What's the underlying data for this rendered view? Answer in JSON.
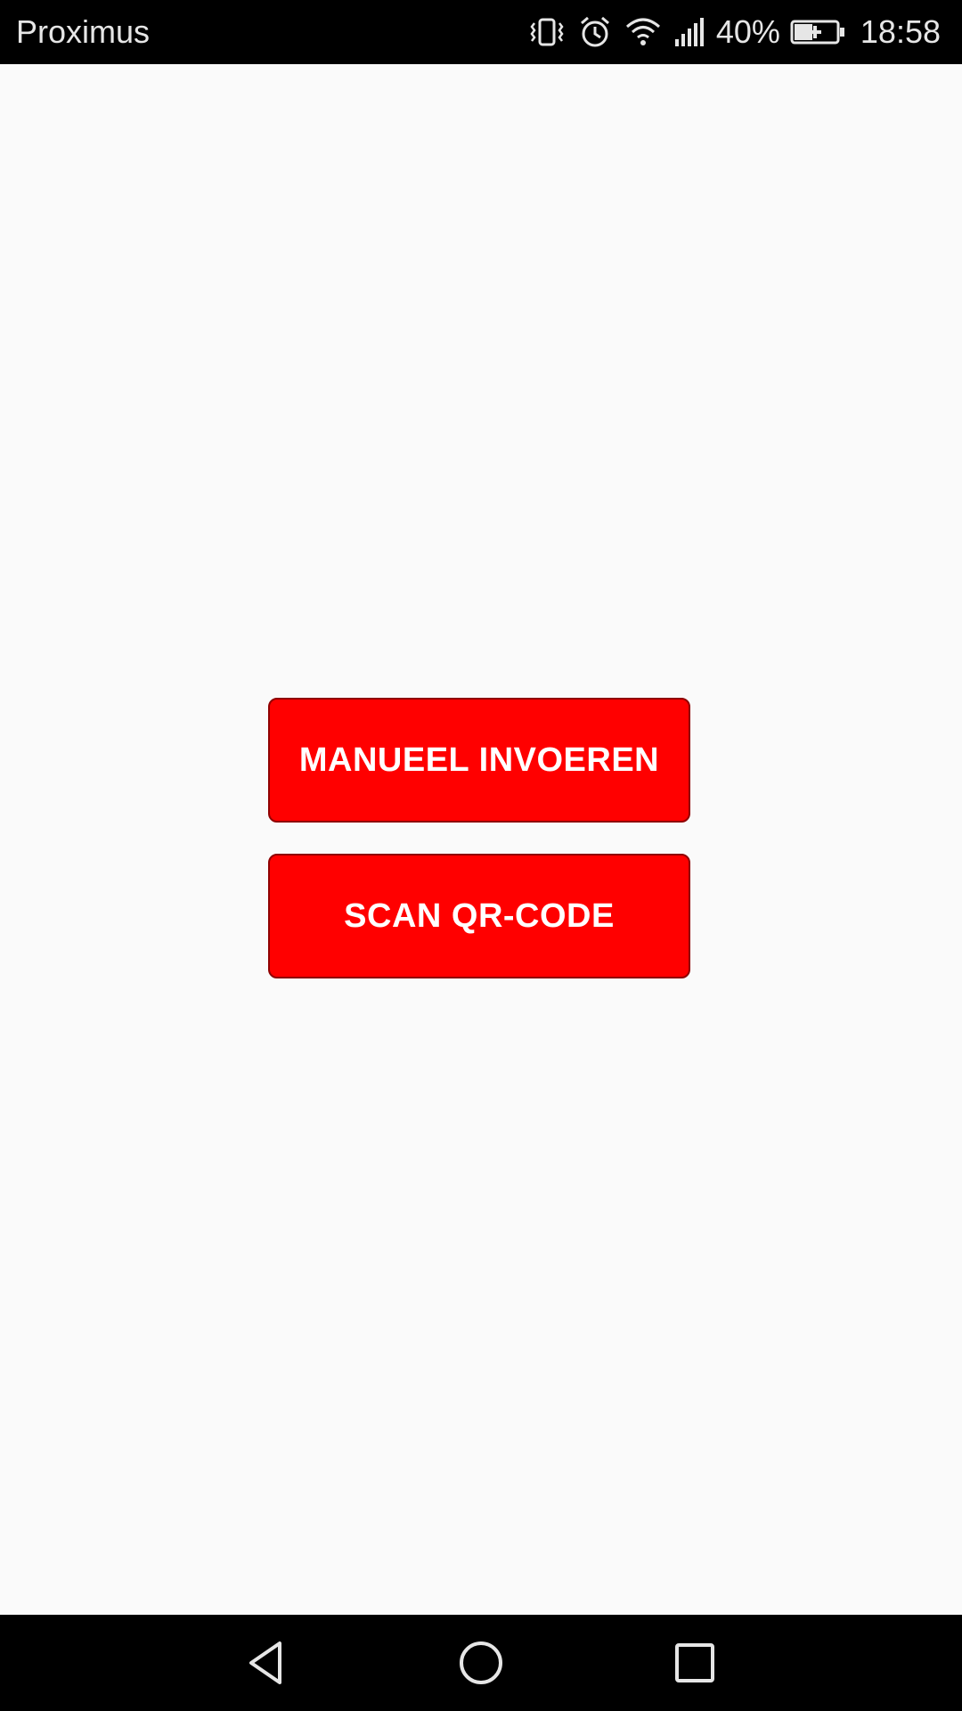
{
  "status_bar": {
    "carrier": "Proximus",
    "battery_percent": "40%",
    "time": "18:58",
    "icons": [
      "vibrate-icon",
      "alarm-icon",
      "wifi-icon",
      "cellular-signal-icon",
      "battery-charging-icon"
    ]
  },
  "main": {
    "manual_button_label": "MANUEEL INVOEREN",
    "scan_button_label": "SCAN QR-CODE"
  },
  "nav_bar": {
    "icons": [
      "back-icon",
      "home-icon",
      "recents-icon"
    ]
  },
  "colors": {
    "button_background": "#ff0000",
    "button_border": "#8f0000",
    "button_text": "#ffffff",
    "page_background": "#fafafa",
    "system_bars": "#000000"
  }
}
